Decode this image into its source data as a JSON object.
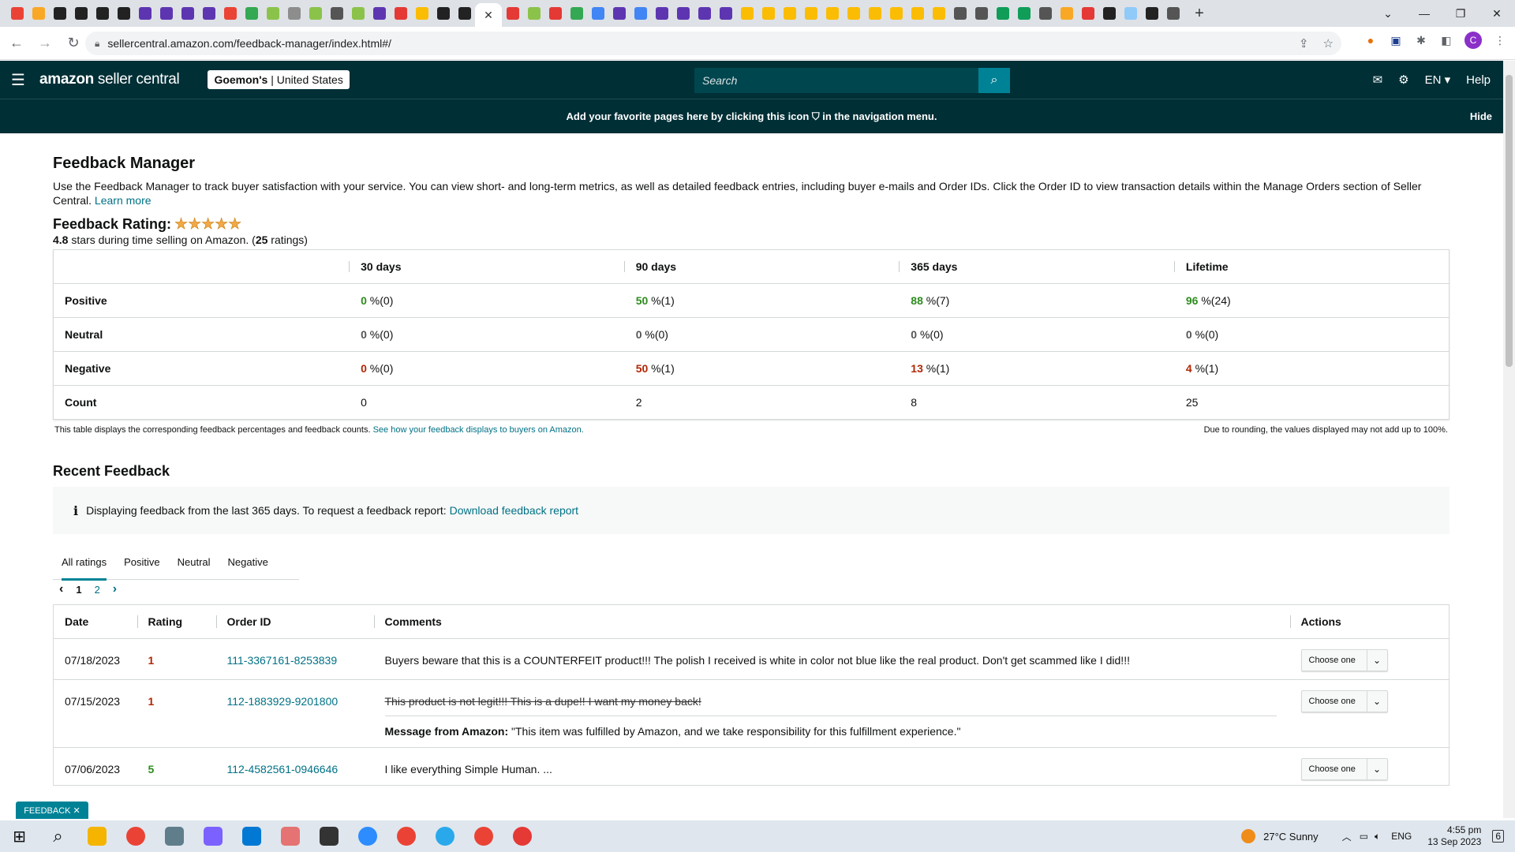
{
  "browser": {
    "active_tab_close": "✕",
    "new_tab": "+",
    "url": "sellercentral.amazon.com/feedback-manager/index.html#/",
    "profile_initial": "C"
  },
  "nav": {
    "logo_bold": "amazon",
    "logo_rest": " seller central",
    "store_name": "Goemon's",
    "store_region": "United States",
    "search_placeholder": "Search",
    "language": "EN",
    "help": "Help"
  },
  "banner": {
    "text": "Add your favorite pages here by clicking this icon ⛉ in the navigation menu.",
    "hide": "Hide"
  },
  "page": {
    "title": "Feedback Manager",
    "intro": "Use the Feedback Manager to track buyer satisfaction with your service. You can view short- and long-term metrics, as well as detailed feedback entries, including buyer e-mails and Order IDs. Click the Order ID to view transaction details within the Manage Orders section of Seller Central.",
    "learn_more": "Learn more",
    "rating_heading": "Feedback Rating:",
    "stars": "★★★★★",
    "rating_value": "4.8",
    "rating_text": " stars during time selling on Amazon. (",
    "rating_count": "25",
    "rating_suffix": " ratings)"
  },
  "metrics": {
    "headers": [
      "30 days",
      "90 days",
      "365 days",
      "Lifetime"
    ],
    "rows": [
      {
        "label": "Positive",
        "cells": [
          {
            "v": "0",
            "s": " %(0)"
          },
          {
            "v": "50",
            "s": " %(1)"
          },
          {
            "v": "88",
            "s": " %(7)"
          },
          {
            "v": "96",
            "s": " %(24)"
          }
        ]
      },
      {
        "label": "Neutral",
        "cells": [
          {
            "v": "0",
            "s": " %(0)"
          },
          {
            "v": "0",
            "s": " %(0)"
          },
          {
            "v": "0",
            "s": " %(0)"
          },
          {
            "v": "0",
            "s": " %(0)"
          }
        ]
      },
      {
        "label": "Negative",
        "cells": [
          {
            "v": "0",
            "s": " %(0)"
          },
          {
            "v": "50",
            "s": " %(1)"
          },
          {
            "v": "13",
            "s": " %(1)"
          },
          {
            "v": "4",
            "s": " %(1)"
          }
        ]
      },
      {
        "label": "Count",
        "cells": [
          {
            "v": "0"
          },
          {
            "v": "2"
          },
          {
            "v": "8"
          },
          {
            "v": "25"
          }
        ]
      }
    ],
    "note_left": "This table displays the corresponding feedback percentages and feedback counts. ",
    "note_link": "See how your feedback displays to buyers on Amazon.",
    "note_right": "Due to rounding, the values displayed may not add up to 100%."
  },
  "recent": {
    "heading": "Recent Feedback",
    "info_icon": "i",
    "info_text": "Displaying feedback from the last 365 days. To request a feedback report: ",
    "info_link": "Download feedback report",
    "tabs": [
      "All ratings",
      "Positive",
      "Neutral",
      "Negative"
    ],
    "pager": {
      "prev": "‹",
      "page1": "1",
      "page2": "2",
      "next": "›"
    },
    "columns": [
      "Date",
      "Rating",
      "Order ID",
      "Comments",
      "Actions"
    ],
    "rows": [
      {
        "date": "07/18/2023",
        "rating": "1",
        "order": "111-3367161-8253839",
        "comment": "Buyers beware that this is a COUNTERFEIT product!!! The polish I received is white in color not blue like the real product. Don't get scammed like I did!!!",
        "action": "Choose one"
      },
      {
        "date": "07/15/2023",
        "rating": "1",
        "order": "112-1883929-9201800",
        "comment": "This product is not legit!!! This is a dupe!! I want my money back!",
        "msg_label": "Message from Amazon:",
        "msg_text": " \"This item was fulfilled by Amazon, and we take responsibility for this fulfillment experience.\"",
        "action": "Choose one"
      },
      {
        "date": "07/06/2023",
        "rating": "5",
        "order": "112-4582561-0946646",
        "comment": "I like everything Simple Human. ...",
        "action": "Choose one"
      }
    ]
  },
  "feedback_tab": "FEEDBACK ✕",
  "taskbar": {
    "weather": "27°C  Sunny",
    "lang": "ENG",
    "time": "4:55 pm",
    "date": "13 Sep 2023",
    "notif": "6"
  },
  "colors": {
    "nav_bg": "#002f36",
    "accent": "#008296",
    "link": "#007185",
    "positive": "#2d8c1e",
    "negative": "#b12704"
  }
}
